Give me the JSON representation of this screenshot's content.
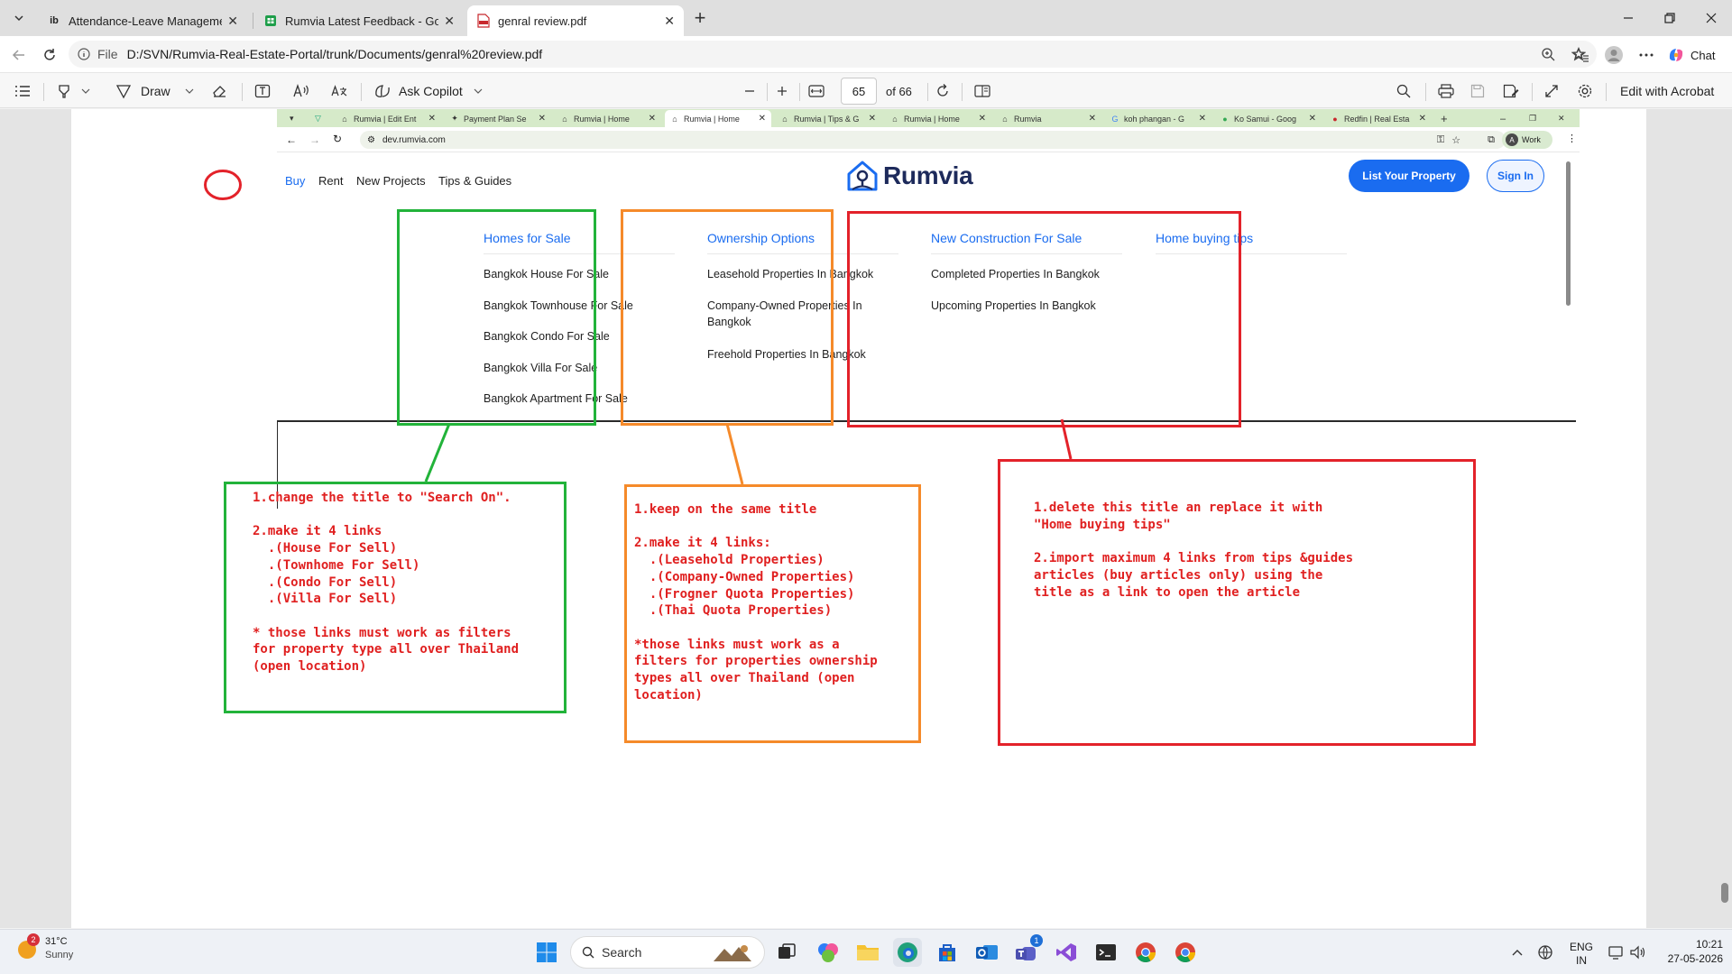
{
  "browser": {
    "tabs": [
      {
        "title": "Attendance-Leave Management Sy",
        "favicon": "ib",
        "active": false
      },
      {
        "title": "Rumvia Latest Feedback - Google",
        "favicon": "sheets-icon",
        "active": false
      },
      {
        "title": "genral review.pdf",
        "favicon": "pdf-icon",
        "active": true
      }
    ],
    "new_tab": "+",
    "address": {
      "scheme_label": "File",
      "url": "D:/SVN/Rumvia-Real-Estate-Portal/trunk/Documents/genral%20review.pdf"
    },
    "chat_label": "Chat"
  },
  "pdf_toolbar": {
    "draw_label": "Draw",
    "copilot_label": "Ask Copilot",
    "page_current": "65",
    "page_total": "of 66",
    "edit_acrobat": "Edit with Acrobat"
  },
  "embedded": {
    "tabs": [
      {
        "title": "Rumvia | Edit Ent"
      },
      {
        "title": "Payment Plan Se"
      },
      {
        "title": "Rumvia | Home"
      },
      {
        "title": "Rumvia | Home",
        "active": true
      },
      {
        "title": "Rumvia | Tips & G"
      },
      {
        "title": "Rumvia | Home"
      },
      {
        "title": "Rumvia"
      },
      {
        "title": "koh phangan - G"
      },
      {
        "title": "Ko Samui - Goog"
      },
      {
        "title": "Redfin | Real Esta"
      }
    ],
    "url": "dev.rumvia.com",
    "profile_initial": "A",
    "profile_label": "Work",
    "site": {
      "nav": {
        "buy": "Buy",
        "rent": "Rent",
        "new_projects": "New Projects",
        "tips": "Tips & Guides"
      },
      "logo_text": "Rumvia",
      "list_property": "List Your Property",
      "sign_in": "Sign In",
      "columns": [
        {
          "title": "Homes for Sale",
          "links": [
            "Bangkok House For Sale",
            "Bangkok Townhouse For Sale",
            "Bangkok Condo For Sale",
            "Bangkok Villa For Sale",
            "Bangkok Apartment For Sale"
          ]
        },
        {
          "title": "Ownership Options",
          "links": [
            "Leasehold Properties In Bangkok",
            "Company-Owned Properties In Bangkok",
            "Freehold Properties In Bangkok"
          ]
        },
        {
          "title": "New Construction For Sale",
          "links": [
            "Completed Properties In Bangkok",
            "Upcoming Properties In Bangkok"
          ]
        },
        {
          "title": "Home buying tips",
          "links": []
        }
      ]
    }
  },
  "annotations": {
    "green": "1.change the title to \"Search On\".\n\n2.make it 4 links\n  .(House For Sell)\n  .(Townhome For Sell)\n  .(Condo For Sell)\n  .(Villa For Sell)\n\n* those links must work as filters\nfor property type all over Thailand\n(open location)",
    "orange": "1.keep on the same title\n\n2.make it 4 links:\n  .(Leasehold Properties)\n  .(Company-Owned Properties)\n  .(Frogner Quota Properties)\n  .(Thai Quota Properties)\n\n*those links must work as a\nfilters for properties ownership\ntypes all over Thailand (open\nlocation)",
    "red": "1.delete this title an replace it with\n\"Home buying tips\"\n\n2.import maximum 4 links from tips &guides\narticles (buy articles only) using the\ntitle as a link to open the article",
    "colors": {
      "green": "#22b33a",
      "orange": "#f58a2a",
      "red": "#e3222a"
    }
  },
  "taskbar": {
    "weather_temp": "31°C",
    "weather_desc": "Sunny",
    "weather_badge": "2",
    "search_label": "Search",
    "teams_badge": "1",
    "lang_top": "ENG",
    "lang_bottom": "IN",
    "time": "10:21",
    "date": "27-05-2026"
  }
}
